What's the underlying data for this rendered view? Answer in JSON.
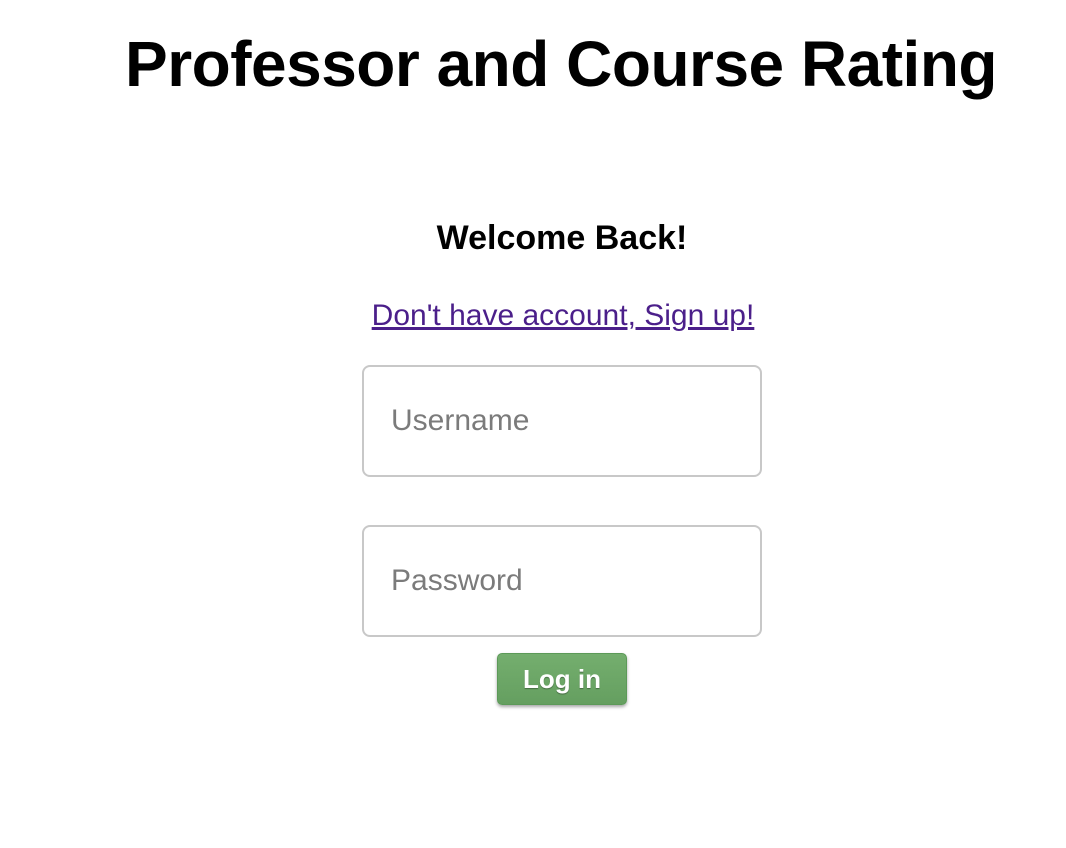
{
  "header": {
    "title": "Professor and Course Rating"
  },
  "login": {
    "heading": "Welcome Back!",
    "signup_link": "Don't have account, Sign up!",
    "username": {
      "value": "",
      "placeholder": "Username"
    },
    "password": {
      "value": "",
      "placeholder": "Password"
    },
    "submit_label": "Log in"
  },
  "colors": {
    "link": "#4b1f8a",
    "button": "#6ca766",
    "input_border": "#c8c8c8"
  }
}
